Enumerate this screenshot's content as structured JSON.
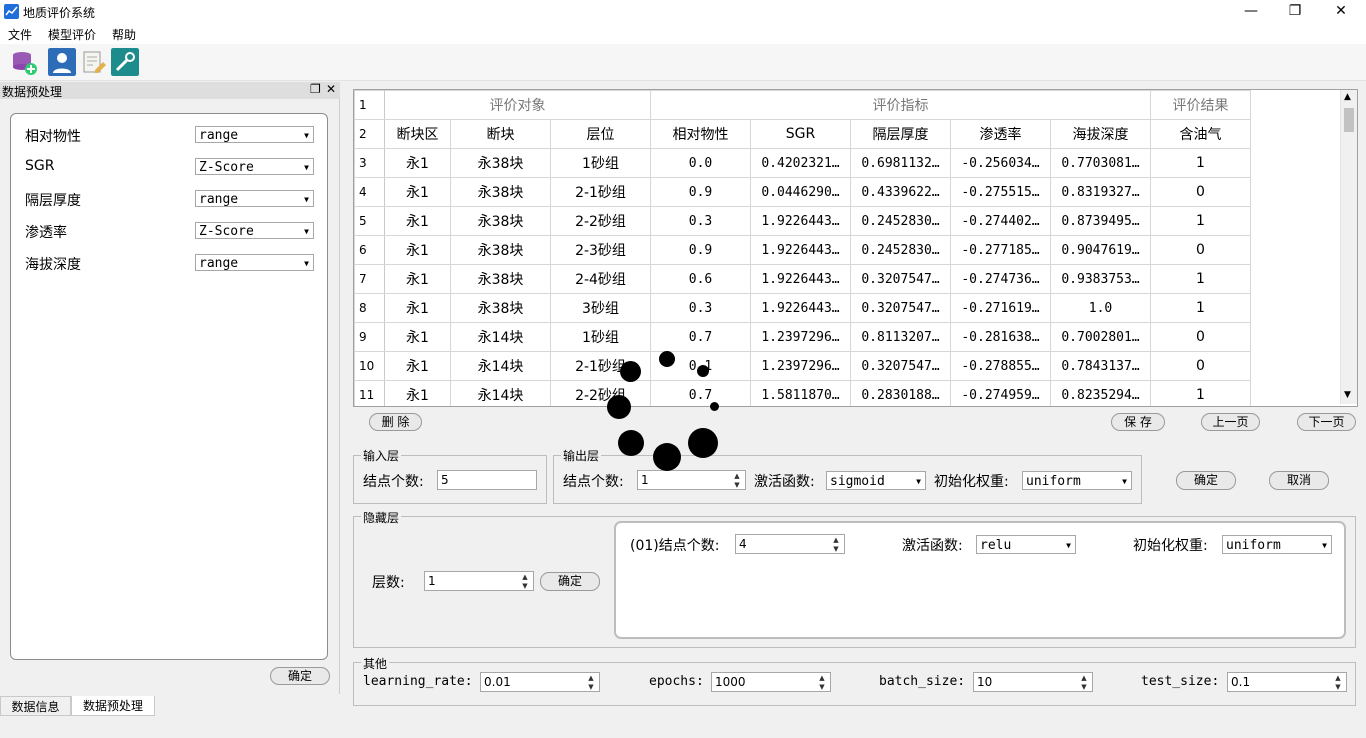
{
  "window": {
    "title": "地质评价系统",
    "minimize": "—",
    "restore": "❐",
    "close": "✕"
  },
  "menu": [
    "文件",
    "模型评价",
    "帮助"
  ],
  "toolbar": {
    "icons": [
      "database-add-icon",
      "user-icon",
      "document-edit-icon",
      "tools-icon"
    ]
  },
  "dock": {
    "title": "数据预处理",
    "params": [
      {
        "label": "相对物性",
        "value": "range"
      },
      {
        "label": "SGR",
        "value": "Z-Score"
      },
      {
        "label": "隔层厚度",
        "value": "range"
      },
      {
        "label": "渗透率",
        "value": "Z-Score"
      },
      {
        "label": "海拔深度",
        "value": "range"
      }
    ],
    "confirm": "确定",
    "tabs": [
      "数据信息",
      "数据预处理"
    ]
  },
  "table": {
    "row1": {
      "num": "1",
      "g1": "评价对象",
      "g2": "评价指标",
      "g3": "评价结果"
    },
    "row2": {
      "num": "2",
      "cols": [
        "断块区",
        "断块",
        "层位",
        "相对物性",
        "SGR",
        "隔层厚度",
        "渗透率",
        "海拔深度",
        "含油气"
      ]
    },
    "rows": [
      {
        "num": "3",
        "cells": [
          "永1",
          "永38块",
          "1砂组",
          "0.0",
          "0.4202321…",
          "0.6981132…",
          "-0.256034…",
          "0.7703081…",
          "1"
        ]
      },
      {
        "num": "4",
        "cells": [
          "永1",
          "永38块",
          "2-1砂组",
          "0.9",
          "0.0446290…",
          "0.4339622…",
          "-0.275515…",
          "0.8319327…",
          "0"
        ]
      },
      {
        "num": "5",
        "cells": [
          "永1",
          "永38块",
          "2-2砂组",
          "0.3",
          "1.9226443…",
          "0.2452830…",
          "-0.274402…",
          "0.8739495…",
          "1"
        ]
      },
      {
        "num": "6",
        "cells": [
          "永1",
          "永38块",
          "2-3砂组",
          "0.9",
          "1.9226443…",
          "0.2452830…",
          "-0.277185…",
          "0.9047619…",
          "0"
        ]
      },
      {
        "num": "7",
        "cells": [
          "永1",
          "永38块",
          "2-4砂组",
          "0.6",
          "1.9226443…",
          "0.3207547…",
          "-0.274736…",
          "0.9383753…",
          "1"
        ]
      },
      {
        "num": "8",
        "cells": [
          "永1",
          "永38块",
          "3砂组",
          "0.3",
          "1.9226443…",
          "0.3207547…",
          "-0.271619…",
          "1.0",
          "1"
        ]
      },
      {
        "num": "9",
        "cells": [
          "永1",
          "永14块",
          "1砂组",
          "0.7",
          "1.2397296…",
          "0.8113207…",
          "-0.281638…",
          "0.7002801…",
          "0"
        ]
      },
      {
        "num": "10",
        "cells": [
          "永1",
          "永14块",
          "2-1砂组",
          "0.1",
          "1.2397296…",
          "0.3207547…",
          "-0.278855…",
          "0.7843137…",
          "0"
        ]
      },
      {
        "num": "11",
        "cells": [
          "永1",
          "永14块",
          "2-2砂组",
          "0.7",
          "1.5811870…",
          "0.2830188…",
          "-0.274959…",
          "0.8235294…",
          "1"
        ]
      }
    ]
  },
  "actions": {
    "delete": "删 除",
    "save": "保 存",
    "prev": "上一页",
    "next": "下一页"
  },
  "input_layer": {
    "title": "输入层",
    "nodes_label": "结点个数:",
    "nodes": "5"
  },
  "output_layer": {
    "title": "输出层",
    "nodes_label": "结点个数:",
    "nodes": "1",
    "act_label": "激活函数:",
    "act": "sigmoid",
    "init_label": "初始化权重:",
    "init": "uniform"
  },
  "layer_buttons": {
    "confirm": "确定",
    "cancel": "取消"
  },
  "hidden": {
    "title": "隐藏层",
    "layers_label": "层数:",
    "layers": "1",
    "confirm": "确定",
    "item": {
      "nodes_label": "(01)结点个数:",
      "nodes": "4",
      "act_label": "激活函数:",
      "act": "relu",
      "init_label": "初始化权重:",
      "init": "uniform"
    }
  },
  "other": {
    "title": "其他",
    "lr_label": "learning_rate:",
    "lr": "0.01",
    "epochs_label": "epochs:",
    "epochs": "1000",
    "batch_label": "batch_size:",
    "batch": "10",
    "test_label": "test_size:",
    "test": "0.1"
  }
}
